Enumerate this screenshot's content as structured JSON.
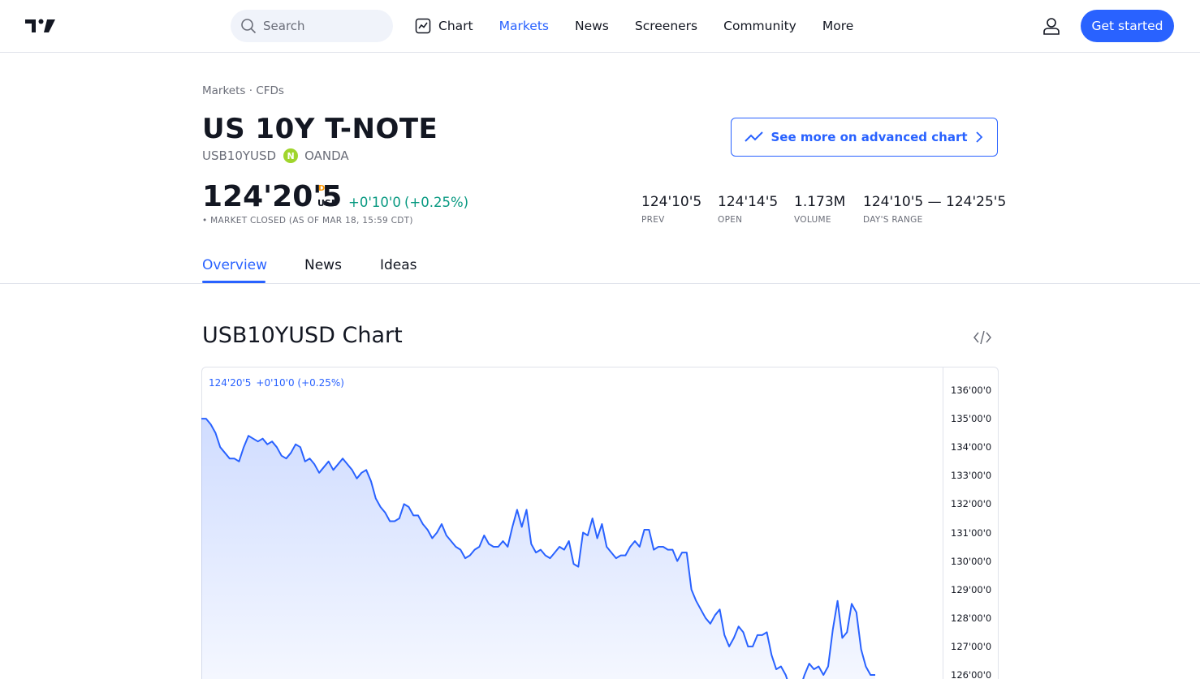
{
  "nav": {
    "search_placeholder": "Search",
    "items": [
      {
        "label": "Chart"
      },
      {
        "label": "Markets"
      },
      {
        "label": "News"
      },
      {
        "label": "Screeners"
      },
      {
        "label": "Community"
      },
      {
        "label": "More"
      }
    ],
    "active": "Markets",
    "get_started": "Get started"
  },
  "header": {
    "breadcrumb": "Markets · CFDs",
    "title": "US 10Y T-NOTE",
    "symbol": "USB10YUSD",
    "exchange": "OANDA",
    "advanced_chart_label": "See more on advanced chart",
    "price": "124'20'5",
    "price_flag": "D",
    "currency": "USD",
    "change": "+0'10'0",
    "change_pct": "(+0.25%)",
    "market_status": "• MARKET CLOSED (AS OF MAR 18, 15:59 CDT)",
    "stats": [
      {
        "value": "124'10'5",
        "label": "PREV"
      },
      {
        "value": "124'14'5",
        "label": "OPEN"
      },
      {
        "value": "1.173M",
        "label": "VOLUME"
      },
      {
        "value": "124'10'5 — 124'25'5",
        "label": "DAY'S RANGE"
      }
    ]
  },
  "tabs": [
    {
      "label": "Overview"
    },
    {
      "label": "News"
    },
    {
      "label": "Ideas"
    }
  ],
  "active_tab": "Overview",
  "chart_section": {
    "title": "USB10YUSD Chart",
    "legend_price": "124'20'5",
    "legend_change": "+0'10'0 (+0.25%)"
  },
  "colors": {
    "accent": "#2962ff",
    "positive": "#089981",
    "warning": "#ff9800",
    "oanda": "#a0d52c"
  },
  "chart_data": {
    "type": "area",
    "title": "",
    "xlabel": "",
    "ylabel": "",
    "ylim": [
      125.5,
      136.6
    ],
    "y_tick_labels": [
      "136'00'0",
      "135'00'0",
      "134'00'0",
      "133'00'0",
      "132'00'0",
      "131'00'0",
      "130'00'0",
      "129'00'0",
      "128'00'0",
      "127'00'0",
      "126'00'0"
    ],
    "y_ticks": [
      136,
      135,
      134,
      133,
      132,
      131,
      130,
      129,
      128,
      127,
      126
    ],
    "grid": false,
    "series": [
      {
        "values": [
          135.0,
          135.0,
          134.8,
          134.5,
          134.0,
          133.8,
          133.6,
          133.6,
          133.5,
          134.0,
          134.4,
          134.3,
          134.2,
          134.3,
          134.1,
          134.2,
          134.0,
          133.7,
          133.6,
          133.8,
          134.1,
          134.0,
          133.5,
          133.6,
          133.4,
          133.1,
          133.3,
          133.5,
          133.2,
          133.4,
          133.6,
          133.4,
          133.2,
          132.9,
          133.1,
          133.2,
          132.8,
          132.2,
          131.9,
          131.7,
          131.4,
          131.4,
          131.5,
          132.0,
          131.9,
          131.6,
          131.6,
          131.3,
          131.1,
          130.8,
          131.0,
          131.3,
          130.9,
          130.7,
          130.5,
          130.4,
          130.1,
          130.2,
          130.4,
          130.5,
          130.9,
          130.6,
          130.5,
          130.5,
          130.7,
          130.5,
          131.2,
          131.8,
          131.2,
          131.8,
          130.6,
          130.3,
          130.4,
          130.2,
          130.1,
          130.3,
          130.5,
          130.4,
          130.7,
          129.9,
          129.8,
          131.0,
          130.9,
          131.5,
          130.8,
          131.3,
          130.5,
          130.3,
          130.1,
          130.2,
          130.2,
          130.5,
          130.7,
          130.5,
          131.1,
          131.1,
          130.4,
          130.5,
          130.5,
          130.4,
          130.4,
          130.0,
          130.3,
          130.3,
          129.0,
          128.6,
          128.3,
          128.0,
          127.8,
          128.1,
          128.3,
          127.4,
          127.0,
          127.3,
          127.7,
          127.5,
          127.0,
          127.0,
          127.4,
          127.4,
          127.5,
          126.7,
          126.2,
          126.3,
          126.0,
          125.5,
          125.3,
          125.5,
          126.0,
          126.4,
          126.2,
          126.3,
          126.0,
          126.3,
          127.6,
          128.6,
          127.3,
          127.5,
          128.5,
          128.2,
          126.9,
          126.3,
          126.0,
          126.0
        ]
      }
    ]
  }
}
